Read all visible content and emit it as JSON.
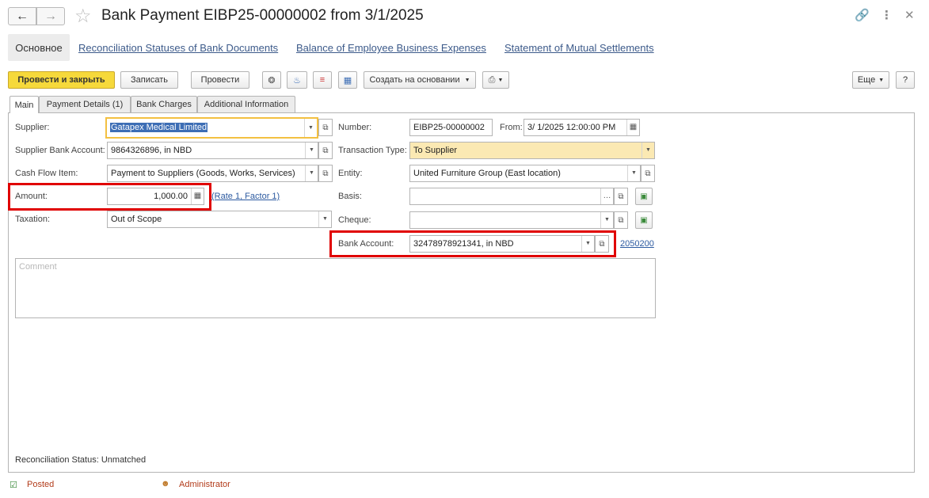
{
  "window": {
    "title": "Bank Payment EIBP25-00000002 from 3/1/2025",
    "icons": [
      "back-arrow-icon",
      "forward-arrow-icon",
      "star-icon",
      "link-icon",
      "more-icon",
      "close-icon"
    ]
  },
  "sections": {
    "active": "Основное",
    "links": [
      "Reconciliation Statuses of Bank Documents",
      "Balance of Employee Business Expenses",
      "Statement of Mutual Settlements"
    ]
  },
  "toolbar": {
    "post_close": "Провести и закрыть",
    "save": "Записать",
    "post": "Провести",
    "create_based_on": "Создать на основании",
    "more": "Еще",
    "help": "?"
  },
  "tabs": [
    "Main",
    "Payment Details (1)",
    "Bank Charges",
    "Additional Information"
  ],
  "form": {
    "supplier": {
      "label": "Supplier:",
      "value": "Gatapex Medical Limited"
    },
    "supplier_bank_account": {
      "label": "Supplier Bank Account:",
      "value": "9864326896, in NBD"
    },
    "cash_flow_item": {
      "label": "Cash Flow Item:",
      "value": "Payment to Suppliers (Goods, Works, Services)"
    },
    "amount": {
      "label": "Amount:",
      "value": "1,000.00",
      "rate_link": "(Rate 1, Factor 1)"
    },
    "taxation": {
      "label": "Taxation:",
      "value": "Out of Scope"
    },
    "number": {
      "label": "Number:",
      "value": "EIBP25-00000002"
    },
    "from": {
      "label": "From:",
      "value": "3/ 1/2025 12:00:00 PM"
    },
    "transaction_type": {
      "label": "Transaction Type:",
      "value": "To Supplier"
    },
    "entity": {
      "label": "Entity:",
      "value": "United Furniture Group (East location)"
    },
    "basis": {
      "label": "Basis:",
      "value": ""
    },
    "cheque": {
      "label": "Cheque:",
      "value": ""
    },
    "bank_account": {
      "label": "Bank Account:",
      "value": "32478978921341, in NBD",
      "link": "2050200"
    },
    "comment": {
      "placeholder": "Comment"
    }
  },
  "reconciliation": {
    "label": "Reconciliation Status:",
    "value": "Unmatched"
  },
  "footer": {
    "status": "Posted",
    "user": "Administrator"
  },
  "colors": {
    "primary_button": "#f6d93b",
    "highlight_border": "#f3c041",
    "red_box": "#e00000",
    "link": "#2c5aa0",
    "yellow_field": "#fbe9b3"
  }
}
